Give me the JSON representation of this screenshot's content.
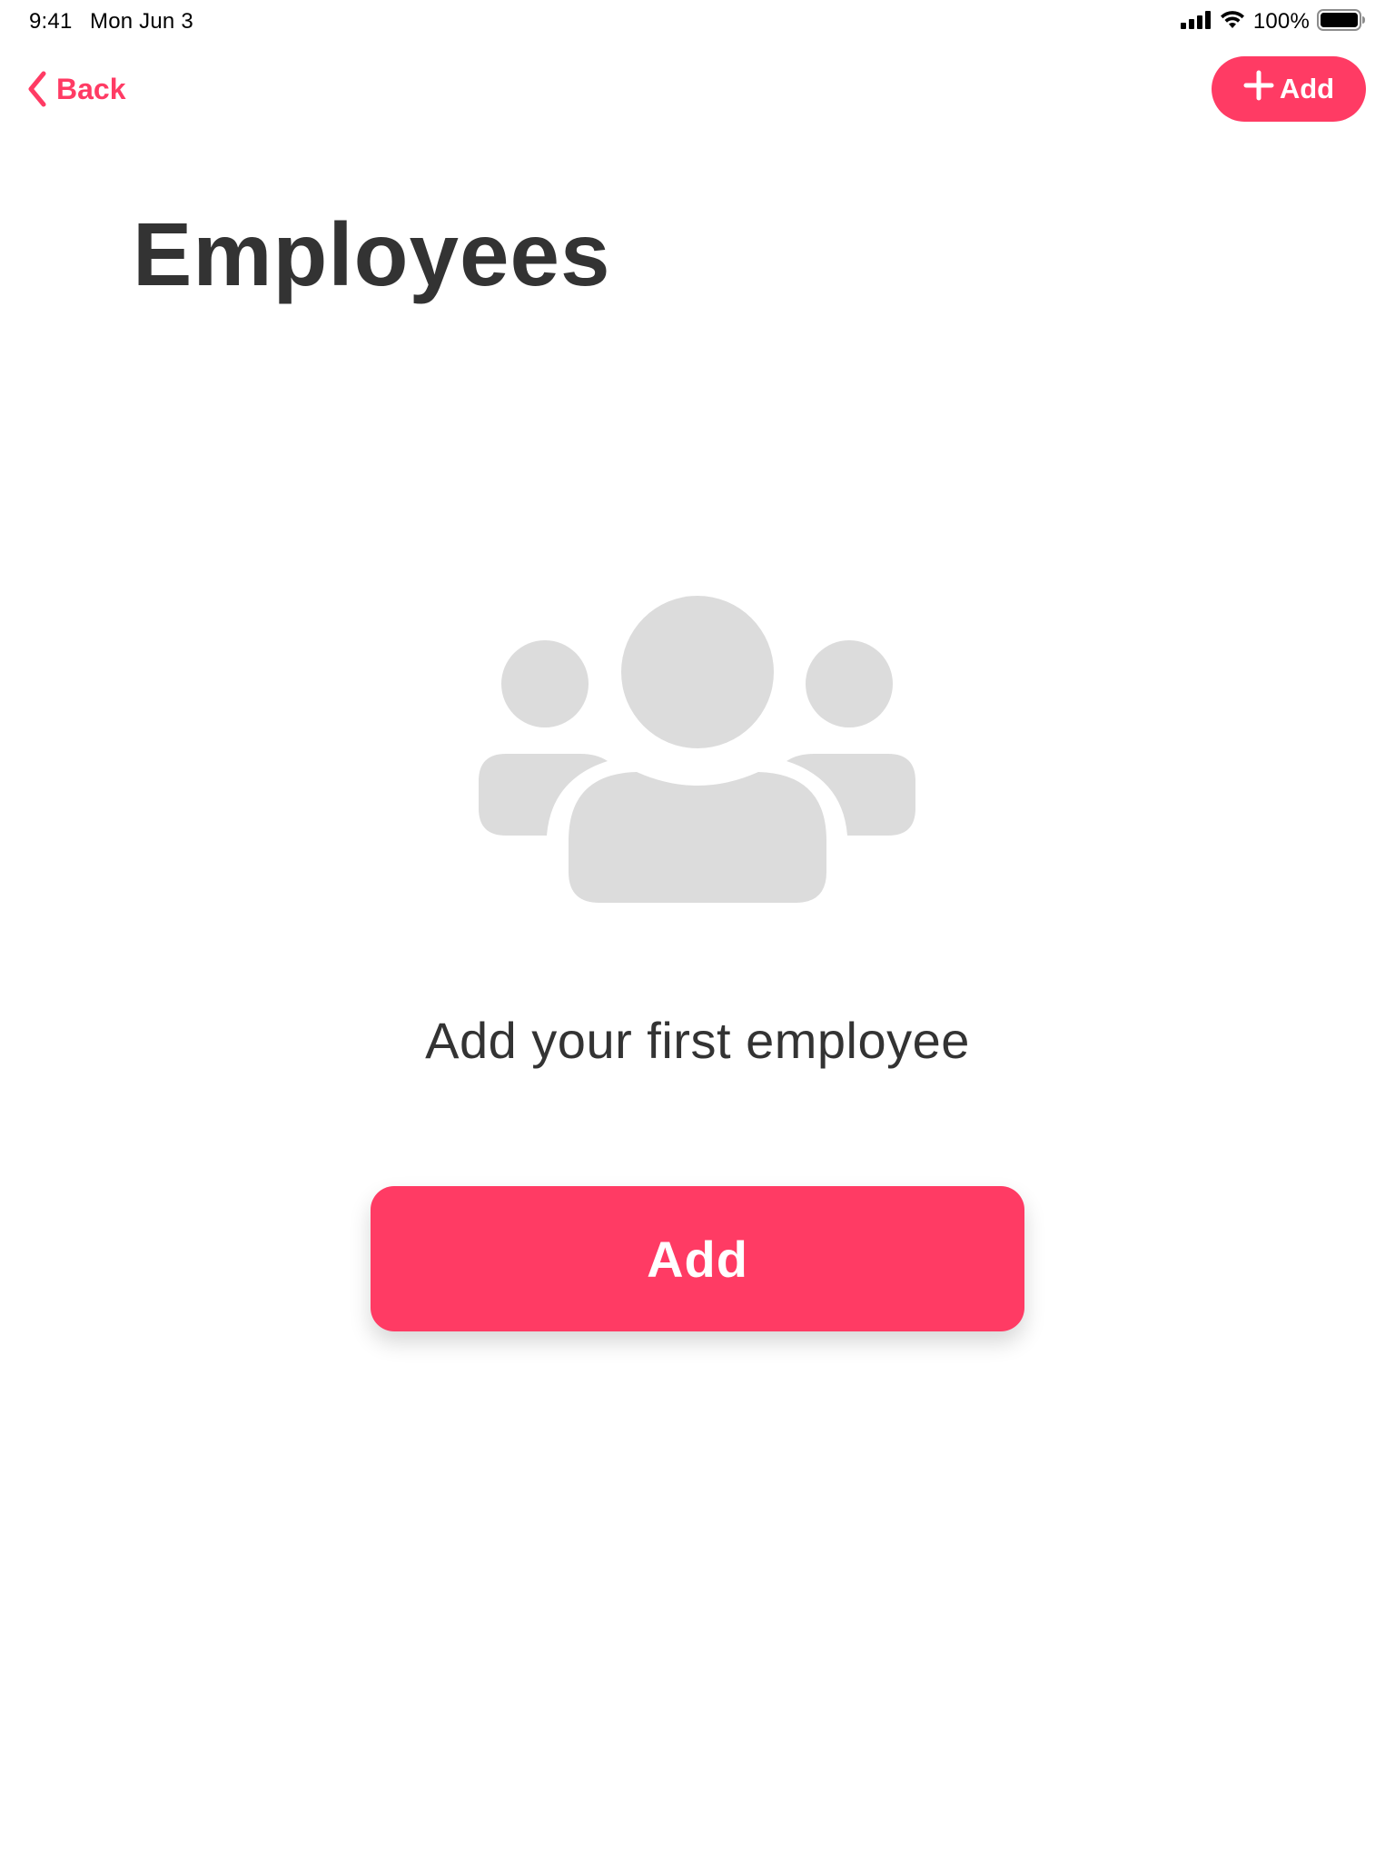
{
  "status_bar": {
    "time": "9:41",
    "date": "Mon Jun 3",
    "battery_percent": "100%",
    "icons": [
      "cellular-signal-icon",
      "wifi-icon",
      "battery-icon"
    ]
  },
  "nav": {
    "back_label": "Back",
    "back_icon": "chevron-left-icon",
    "add_label": "Add",
    "add_icon": "plus-icon"
  },
  "page": {
    "title": "Employees"
  },
  "empty_state": {
    "icon": "people-group-icon",
    "message": "Add your first employee",
    "button_label": "Add"
  },
  "colors": {
    "accent": "#ff3b64",
    "title_text": "#333333",
    "illustration": "#dcdcdc",
    "background": "#ffffff"
  }
}
